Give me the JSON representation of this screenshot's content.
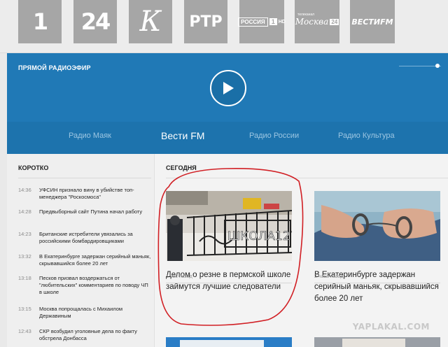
{
  "channels": [
    {
      "name": "1-icon",
      "label": "1"
    },
    {
      "name": "24-icon",
      "label": "24"
    },
    {
      "name": "kultura-icon",
      "label": "К"
    },
    {
      "name": "rtr-icon",
      "label": "РТР"
    },
    {
      "name": "rossiya-hd-icon",
      "label_main": "РОССИЯ",
      "label_one": "1",
      "label_hd": "HD"
    },
    {
      "name": "moskva24-icon",
      "label_sup": "телеканал",
      "label_main": "Москва",
      "label_num": "24"
    },
    {
      "name": "vestifm-icon",
      "label": "ВЕСТИFM"
    }
  ],
  "radio": {
    "live_label": "ПРЯМОЙ РАДИОЭФИР",
    "stations": [
      "Радио Маяк",
      "Вести FM",
      "Радио России",
      "Радио Культура"
    ],
    "active_station": "Вести FM"
  },
  "left": {
    "title": "КОРОТКО",
    "items": [
      {
        "time": "14:36",
        "text": "УФСИН признало вину в убийстве топ-менеджера \"Роскосмоса\""
      },
      {
        "time": "14:28",
        "text": "Предвыборный сайт Путина начал работу"
      },
      {
        "time": "14:23",
        "text": "Британские истребители увязались за российскими бомбардировщиками"
      },
      {
        "time": "13:32",
        "text": "В Екатеринбурге задержан серийный маньяк, скрывавшийся более 20 лет"
      },
      {
        "time": "13:18",
        "text": "Песков призвал воздержаться от \"любительских\" комментариев по поводу ЧП в школе"
      },
      {
        "time": "13:15",
        "text": "Москва попрощалась с Михаилом Державиным"
      },
      {
        "time": "12:43",
        "text": "СКР возбудил уголовные дела по факту обстрела Донбасса"
      }
    ]
  },
  "right": {
    "title": "СЕГОДНЯ",
    "cards": [
      {
        "title": "Делом о резне в пермской школе займутся лучшие следователи",
        "time": "1 час назад",
        "sign": "ШКОЛА127"
      },
      {
        "title": "В Екатеринбурге задержан серийный маньяк, скрывавшийся более 20 лет",
        "time": "2 часа назад"
      }
    ]
  },
  "watermark": "YAPLAKAL.COM",
  "colors": {
    "radio_bg": "#2079b6",
    "stations_bg": "#1d73ad",
    "channel_tile": "#a6a6a6",
    "annotation": "#d11f24"
  }
}
